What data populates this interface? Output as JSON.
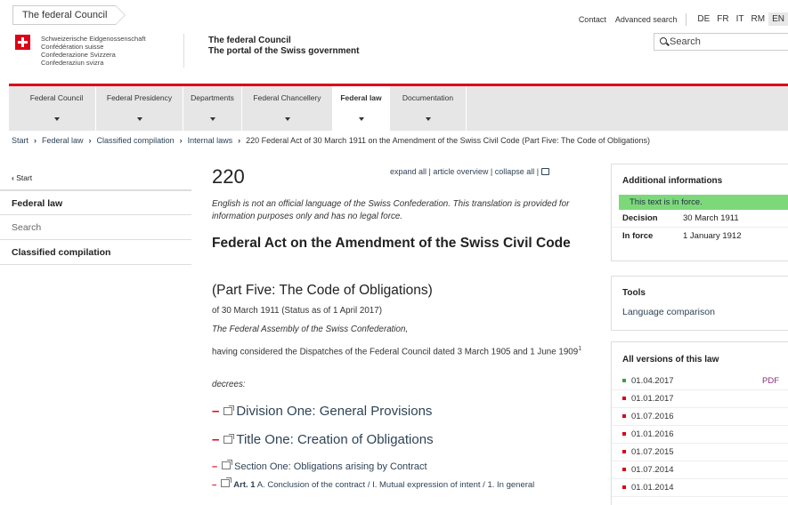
{
  "topbar": {
    "tab": "The federal Council",
    "contact": "Contact",
    "advanced_search": "Advanced search",
    "languages": [
      "DE",
      "FR",
      "IT",
      "RM",
      "EN"
    ],
    "active_language": "EN"
  },
  "header": {
    "confed_lines": [
      "Schweizerische Eidgenossenschaft",
      "Confédération suisse",
      "Confederazione Svizzera",
      "Confederaziun svizra"
    ],
    "portal_line1": "The federal Council",
    "portal_line2": "The portal of the Swiss government",
    "search_placeholder": "Search"
  },
  "nav": {
    "items": [
      "Federal Council",
      "Federal Presidency",
      "Departments",
      "Federal Chancellery",
      "Federal law",
      "Documentation"
    ],
    "active": "Federal law"
  },
  "breadcrumb": {
    "items": [
      "Start",
      "Federal law",
      "Classified compilation",
      "Internal laws"
    ],
    "current": "220 Federal Act of 30 March 1911 on the Amendment of the Swiss Civil Code (Part Five: The Code of Obligations)"
  },
  "sidebar": {
    "back": "Start",
    "items": [
      "Federal law",
      "Search",
      "Classified compilation"
    ]
  },
  "main": {
    "number": "220",
    "expand_all": "expand all",
    "article_overview": "article overview",
    "collapse_all": "collapse all",
    "note": "English is not an official language of the Swiss Confederation. This translation is provided for information purposes only and has no legal force.",
    "title": "Federal Act on the Amendment of the Swiss Civil Code",
    "subtitle": "(Part Five: The Code of Obligations)",
    "date_line": "of 30 March 1911 (Status as of 1 April 2017)",
    "assembly": "The Federal Assembly of the Swiss Confederation,",
    "considered": "having considered the Dispatches of the Federal Council dated 3 March 1905 and 1 June 1909",
    "footnote": "1",
    "decrees": "decrees:",
    "division": "Division One: General Provisions",
    "title_one": "Title One: Creation of Obligations",
    "section_one": "Section One: Obligations arising by Contract",
    "art_label": "Art. 1",
    "art_text": "A. Conclusion of the contract / I. Mutual expression of intent / 1. In general"
  },
  "info_panel": {
    "heading": "Additional informations",
    "status": "This text is in force.",
    "decision_label": "Decision",
    "decision_value": "30 March 1911",
    "inforce_label": "In force",
    "inforce_value": "1 January 1912"
  },
  "tools_panel": {
    "heading": "Tools",
    "link": "Language comparison"
  },
  "versions_panel": {
    "heading": "All versions of this law",
    "versions": [
      "01.04.2017",
      "01.01.2017",
      "01.07.2016",
      "01.01.2016",
      "01.07.2015",
      "01.07.2014",
      "01.01.2014"
    ],
    "pdf": "PDF"
  }
}
